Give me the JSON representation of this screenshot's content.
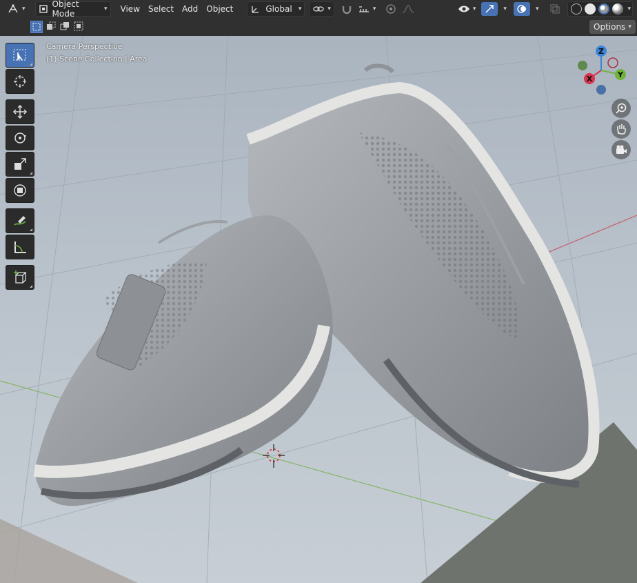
{
  "header": {
    "editor_type_icon": "grid-axes-icon",
    "mode_label": "Object Mode",
    "menus": [
      "View",
      "Select",
      "Add",
      "Object"
    ],
    "transform_orientation_label": "Global",
    "pivot_icon": "link-icon",
    "snap_icon": "magnet-icon",
    "snap_target_icon": "snap-increment-icon",
    "proportional_icon": "proportional-edit-icon",
    "falloff_icon": "falloff-curve-icon",
    "visibility_icon": "eye-icon",
    "gizmo_icon": "gizmo-icon",
    "overlay_icon": "overlay-icon",
    "xray_icon": "xray-icon",
    "shading_modes": [
      "wireframe",
      "solid",
      "material-preview",
      "rendered"
    ],
    "active_shading": "material-preview"
  },
  "subbar": {
    "select_modes": [
      "new",
      "extend",
      "subtract",
      "invert"
    ],
    "options_label": "Options"
  },
  "viewport": {
    "camera_label": "Camera Perspective",
    "collection_label": "(1) Scene Collection | Area",
    "gizmo": {
      "z": "Z",
      "y": "Y",
      "x": "X"
    },
    "nav_buttons": [
      "zoom-icon",
      "hand-icon",
      "camera-icon"
    ]
  },
  "toolbar": {
    "tools": [
      "select-box-icon",
      "cursor-icon",
      "move-icon",
      "rotate-icon",
      "scale-icon",
      "transform-icon",
      "annotate-icon",
      "measure-icon",
      "add-cube-icon"
    ],
    "active_tool": "select-box-icon"
  },
  "colors": {
    "accent": "#4772b3",
    "x_axis": "#d6334c",
    "y_axis": "#6eb33c",
    "z_axis": "#3b84d8"
  }
}
